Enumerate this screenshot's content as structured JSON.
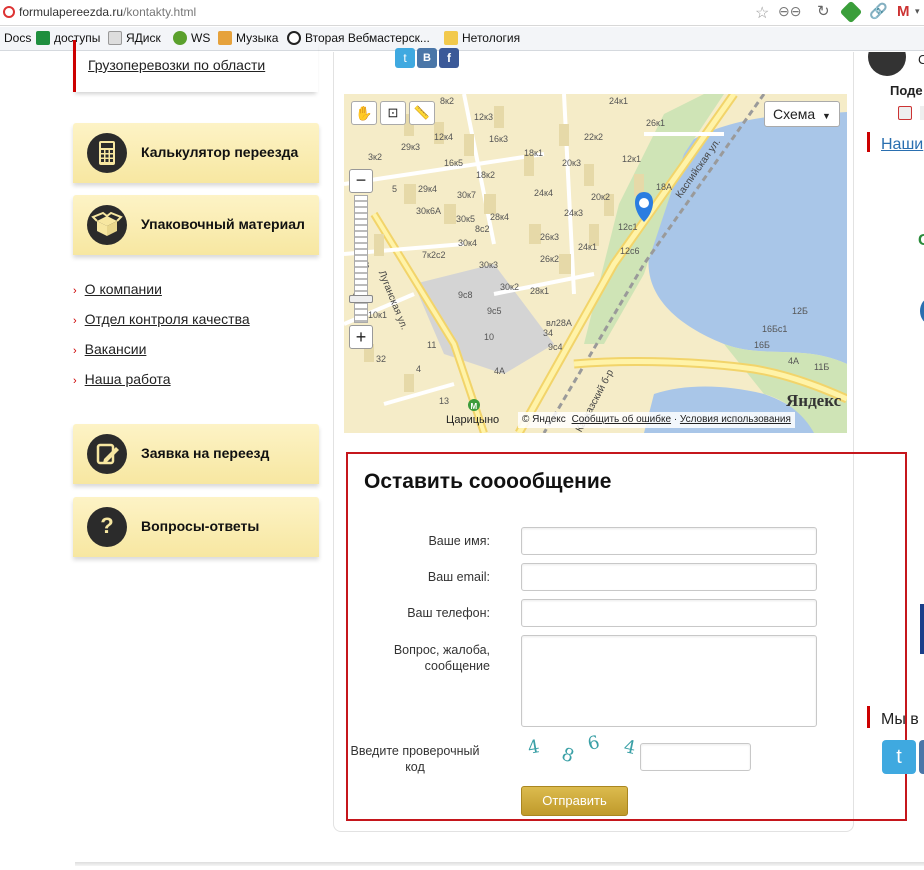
{
  "browser": {
    "url_domain": "formulapereezda.ru",
    "url_path": "/kontakty.html",
    "bookmarks": [
      {
        "label": "Docs"
      },
      {
        "label": "доступы"
      },
      {
        "label": "ЯДиск"
      },
      {
        "label": "WS"
      },
      {
        "label": "Музыка"
      },
      {
        "label": "Вторая Вебмастерск..."
      },
      {
        "label": "Нетология"
      }
    ]
  },
  "sidebar": {
    "top_partial": "Грузоперевозки по области",
    "cards": [
      {
        "label": "Калькулятор переезда",
        "icon": "calculator-icon"
      },
      {
        "label": "Упаковочный материал",
        "icon": "box-icon"
      },
      {
        "label": "Заявка на переезд",
        "icon": "edit-icon"
      },
      {
        "label": "Вопросы-ответы",
        "icon": "question-icon"
      }
    ],
    "links": [
      "О компании",
      "Отдел контроля качества",
      "Вакансии",
      "Наша работа"
    ]
  },
  "map": {
    "mode_button": "Схема",
    "brand": "Яндекс",
    "copyright": "© Яндекс",
    "report_error": "Сообщить об ошибке",
    "terms": "Условия использования",
    "street_1": "Луганская ул.",
    "street_2": "Каспийская ул.",
    "street_3": "Кавказский б-р",
    "metro": "Царицыно",
    "buildings": [
      "8к2",
      "24к1",
      "26к1",
      "12к3",
      "22к2",
      "12к4",
      "16к3",
      "29к3",
      "18к1",
      "20к3",
      "3к2",
      "16к5",
      "18к2",
      "12к1",
      "18А",
      "5",
      "29к4",
      "30к7",
      "24к4",
      "20к2",
      "30к6А",
      "28к4",
      "24к3",
      "30к5",
      "12с1",
      "30к4",
      "26к3",
      "12с6",
      "7к2с2",
      "26к2",
      "24к1",
      "30к3",
      "9с8",
      "30к2",
      "28к1",
      "9с5",
      "вл28А",
      "10",
      "9с4",
      "34",
      "32",
      "4",
      "4А",
      "11",
      "13",
      "12Б",
      "16Б",
      "16Бс1",
      "4А",
      "11Б",
      "11В",
      "4к1",
      "10к1",
      "8с2"
    ]
  },
  "form": {
    "title": "Оставить сооообщение",
    "name_label": "Ваше имя:",
    "email_label": "Ваш email:",
    "phone_label": "Ваш телефон:",
    "message_label_1": "Вопрос, жалоба,",
    "message_label_2": "сообщение",
    "captcha_label_1": "Введите проверочный",
    "captcha_label_2": "код",
    "captcha_text": [
      "4",
      "8",
      "6",
      "4"
    ],
    "submit": "Отправить",
    "name_value": "",
    "email_value": "",
    "phone_value": "",
    "message_value": "",
    "captcha_value": ""
  },
  "right": {
    "partial_top": "С",
    "partial_share": "Поде",
    "partial_link": "Наши",
    "partial_social": "Мы в"
  }
}
